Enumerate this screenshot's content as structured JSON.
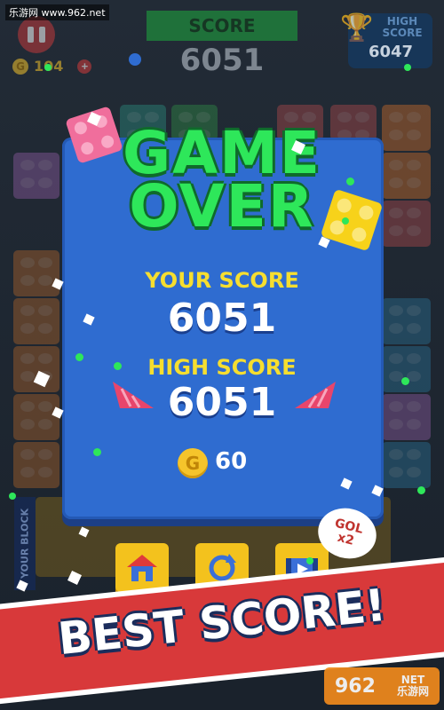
{
  "watermark_top": "乐游网 www.962.net",
  "top_bar": {
    "score_label": "SCORE",
    "score": "6051",
    "coins": "104",
    "high_score_label_line1": "HIGH",
    "high_score_label_line2": "SCORE",
    "high_score": "6047"
  },
  "panel": {
    "title_line1": "GAME",
    "title_line2": "OVER",
    "your_score_label": "YOUR SCORE",
    "your_score": "6051",
    "high_score_label": "HIGH SCORE",
    "high_score": "6051",
    "coins_earned": "60",
    "coin_symbol": "G"
  },
  "buttons": {
    "home_icon": "home-icon",
    "restart_icon": "restart-icon",
    "video_icon": "video-icon"
  },
  "gold_bubble": {
    "line1": "GOL",
    "line2": "x2"
  },
  "side_label": "YOUR BLOCK",
  "banner": {
    "text": "BEST SCORE!"
  },
  "watermark_logo": {
    "number": "962",
    "domain": "NET",
    "name": "乐游网"
  },
  "colors": {
    "panel": "#2f6cd0",
    "title_green": "#2ee75a",
    "label_yellow": "#f6de2f",
    "banner_red": "#d8393a",
    "button_yellow": "#f3c21d"
  }
}
